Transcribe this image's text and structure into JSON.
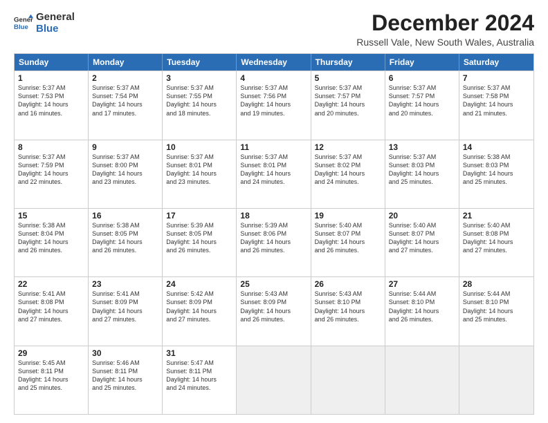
{
  "logo": {
    "general": "General",
    "blue": "Blue"
  },
  "header": {
    "title": "December 2024",
    "location": "Russell Vale, New South Wales, Australia"
  },
  "weekdays": [
    "Sunday",
    "Monday",
    "Tuesday",
    "Wednesday",
    "Thursday",
    "Friday",
    "Saturday"
  ],
  "rows": [
    [
      {
        "day": "",
        "text": "",
        "empty": true
      },
      {
        "day": "2",
        "text": "Sunrise: 5:37 AM\nSunset: 7:54 PM\nDaylight: 14 hours\nand 17 minutes."
      },
      {
        "day": "3",
        "text": "Sunrise: 5:37 AM\nSunset: 7:55 PM\nDaylight: 14 hours\nand 18 minutes."
      },
      {
        "day": "4",
        "text": "Sunrise: 5:37 AM\nSunset: 7:56 PM\nDaylight: 14 hours\nand 19 minutes."
      },
      {
        "day": "5",
        "text": "Sunrise: 5:37 AM\nSunset: 7:57 PM\nDaylight: 14 hours\nand 20 minutes."
      },
      {
        "day": "6",
        "text": "Sunrise: 5:37 AM\nSunset: 7:57 PM\nDaylight: 14 hours\nand 20 minutes."
      },
      {
        "day": "7",
        "text": "Sunrise: 5:37 AM\nSunset: 7:58 PM\nDaylight: 14 hours\nand 21 minutes."
      }
    ],
    [
      {
        "day": "8",
        "text": "Sunrise: 5:37 AM\nSunset: 7:59 PM\nDaylight: 14 hours\nand 22 minutes."
      },
      {
        "day": "9",
        "text": "Sunrise: 5:37 AM\nSunset: 8:00 PM\nDaylight: 14 hours\nand 23 minutes."
      },
      {
        "day": "10",
        "text": "Sunrise: 5:37 AM\nSunset: 8:01 PM\nDaylight: 14 hours\nand 23 minutes."
      },
      {
        "day": "11",
        "text": "Sunrise: 5:37 AM\nSunset: 8:01 PM\nDaylight: 14 hours\nand 24 minutes."
      },
      {
        "day": "12",
        "text": "Sunrise: 5:37 AM\nSunset: 8:02 PM\nDaylight: 14 hours\nand 24 minutes."
      },
      {
        "day": "13",
        "text": "Sunrise: 5:37 AM\nSunset: 8:03 PM\nDaylight: 14 hours\nand 25 minutes."
      },
      {
        "day": "14",
        "text": "Sunrise: 5:38 AM\nSunset: 8:03 PM\nDaylight: 14 hours\nand 25 minutes."
      }
    ],
    [
      {
        "day": "15",
        "text": "Sunrise: 5:38 AM\nSunset: 8:04 PM\nDaylight: 14 hours\nand 26 minutes."
      },
      {
        "day": "16",
        "text": "Sunrise: 5:38 AM\nSunset: 8:05 PM\nDaylight: 14 hours\nand 26 minutes."
      },
      {
        "day": "17",
        "text": "Sunrise: 5:39 AM\nSunset: 8:05 PM\nDaylight: 14 hours\nand 26 minutes."
      },
      {
        "day": "18",
        "text": "Sunrise: 5:39 AM\nSunset: 8:06 PM\nDaylight: 14 hours\nand 26 minutes."
      },
      {
        "day": "19",
        "text": "Sunrise: 5:40 AM\nSunset: 8:07 PM\nDaylight: 14 hours\nand 26 minutes."
      },
      {
        "day": "20",
        "text": "Sunrise: 5:40 AM\nSunset: 8:07 PM\nDaylight: 14 hours\nand 27 minutes."
      },
      {
        "day": "21",
        "text": "Sunrise: 5:40 AM\nSunset: 8:08 PM\nDaylight: 14 hours\nand 27 minutes."
      }
    ],
    [
      {
        "day": "22",
        "text": "Sunrise: 5:41 AM\nSunset: 8:08 PM\nDaylight: 14 hours\nand 27 minutes."
      },
      {
        "day": "23",
        "text": "Sunrise: 5:41 AM\nSunset: 8:09 PM\nDaylight: 14 hours\nand 27 minutes."
      },
      {
        "day": "24",
        "text": "Sunrise: 5:42 AM\nSunset: 8:09 PM\nDaylight: 14 hours\nand 27 minutes."
      },
      {
        "day": "25",
        "text": "Sunrise: 5:43 AM\nSunset: 8:09 PM\nDaylight: 14 hours\nand 26 minutes."
      },
      {
        "day": "26",
        "text": "Sunrise: 5:43 AM\nSunset: 8:10 PM\nDaylight: 14 hours\nand 26 minutes."
      },
      {
        "day": "27",
        "text": "Sunrise: 5:44 AM\nSunset: 8:10 PM\nDaylight: 14 hours\nand 26 minutes."
      },
      {
        "day": "28",
        "text": "Sunrise: 5:44 AM\nSunset: 8:10 PM\nDaylight: 14 hours\nand 25 minutes."
      }
    ],
    [
      {
        "day": "29",
        "text": "Sunrise: 5:45 AM\nSunset: 8:11 PM\nDaylight: 14 hours\nand 25 minutes."
      },
      {
        "day": "30",
        "text": "Sunrise: 5:46 AM\nSunset: 8:11 PM\nDaylight: 14 hours\nand 25 minutes."
      },
      {
        "day": "31",
        "text": "Sunrise: 5:47 AM\nSunset: 8:11 PM\nDaylight: 14 hours\nand 24 minutes."
      },
      {
        "day": "",
        "text": "",
        "empty": true,
        "shaded": true
      },
      {
        "day": "",
        "text": "",
        "empty": true,
        "shaded": true
      },
      {
        "day": "",
        "text": "",
        "empty": true,
        "shaded": true
      },
      {
        "day": "",
        "text": "",
        "empty": true,
        "shaded": true
      }
    ]
  ],
  "row0_day1": {
    "day": "1",
    "text": "Sunrise: 5:37 AM\nSunset: 7:53 PM\nDaylight: 14 hours\nand 16 minutes."
  }
}
